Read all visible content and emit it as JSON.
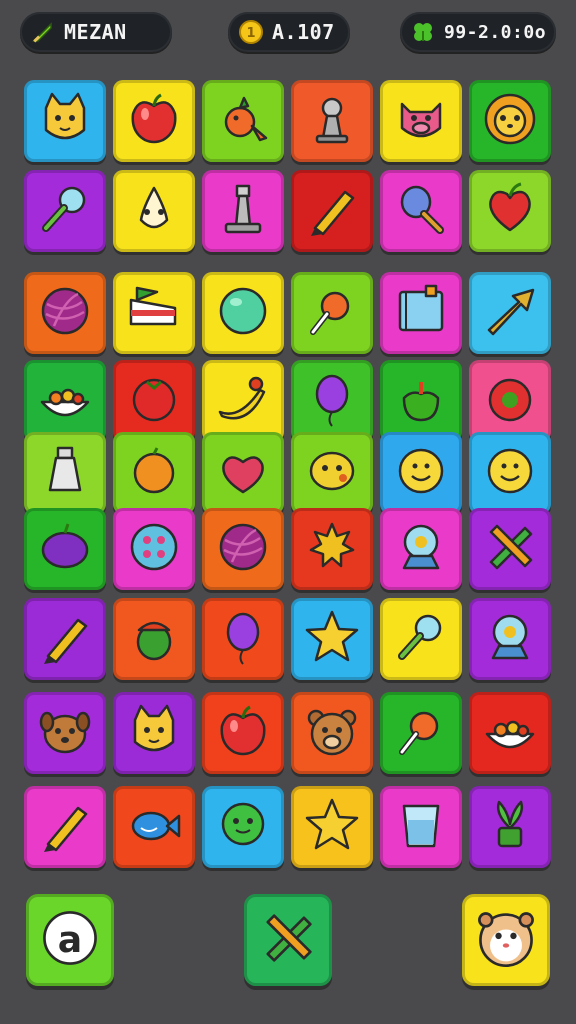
{
  "hud": {
    "left": {
      "text": "MEZAN",
      "icon": "sword-icon"
    },
    "mid": {
      "text": "A.107",
      "icon": "coin-icon"
    },
    "right": {
      "text": "99-2.0:0o",
      "icon": "clover-icon"
    }
  },
  "board": {
    "rows": [
      [
        {
          "c": "#2fb4ee",
          "i": "cat-face"
        },
        {
          "c": "#f7e21b",
          "i": "apple"
        },
        {
          "c": "#7ed321",
          "i": "rooster"
        },
        {
          "c": "#f05a2a",
          "i": "chess-pawn"
        },
        {
          "c": "#f7e21b",
          "i": "pig-face"
        },
        {
          "c": "#27b52a",
          "i": "lion-face"
        }
      ],
      [
        {
          "c": "#a32bd9",
          "i": "magnifier"
        },
        {
          "c": "#f7e21b",
          "i": "onion"
        },
        {
          "c": "#e93ac9",
          "i": "chess-rook"
        },
        {
          "c": "#d61f1f",
          "i": "crayon"
        },
        {
          "c": "#e93ac9",
          "i": "hand-mirror"
        },
        {
          "c": "#8dd62a",
          "i": "heart-fruit"
        }
      ],
      [
        {
          "c": "#f06a1c",
          "i": "yarn-ball"
        },
        {
          "c": "#f7e21b",
          "i": "cake-slice"
        },
        {
          "c": "#f7e21b",
          "i": "ball"
        },
        {
          "c": "#7ed321",
          "i": "lollipop"
        },
        {
          "c": "#e93ac9",
          "i": "notebook"
        },
        {
          "c": "#3cc0ee",
          "i": "arrow"
        }
      ],
      [
        {
          "c": "#22b33b",
          "i": "fruit-bowl"
        },
        {
          "c": "#e52a1f",
          "i": "tomato"
        },
        {
          "c": "#f7e21b",
          "i": "banana"
        },
        {
          "c": "#3fc12a",
          "i": "balloon"
        },
        {
          "c": "#27b52a",
          "i": "bell-pepper"
        },
        {
          "c": "#f0508e",
          "i": "tomato-slice"
        }
      ],
      [
        {
          "c": "#8dd62a",
          "i": "bottle"
        },
        {
          "c": "#7ed321",
          "i": "orange"
        },
        {
          "c": "#7ed321",
          "i": "heart"
        },
        {
          "c": "#7ed321",
          "i": "lemon-face"
        },
        {
          "c": "#2fa8ee",
          "i": "smiley"
        },
        {
          "c": "#2fb4ee",
          "i": "smiley"
        }
      ],
      [
        {
          "c": "#27b52a",
          "i": "plum"
        },
        {
          "c": "#e93ac9",
          "i": "button"
        },
        {
          "c": "#f06a1c",
          "i": "yarn-ball"
        },
        {
          "c": "#e5381f",
          "i": "sun-fruit"
        },
        {
          "c": "#e93ac9",
          "i": "snow-globe"
        },
        {
          "c": "#a32bd9",
          "i": "crossed-tools"
        }
      ],
      [
        {
          "c": "#9b2bd6",
          "i": "crayon"
        },
        {
          "c": "#f0581f",
          "i": "acorn"
        },
        {
          "c": "#f04a1c",
          "i": "balloon"
        },
        {
          "c": "#2fb4ee",
          "i": "star"
        },
        {
          "c": "#f7e21b",
          "i": "magnifier"
        },
        {
          "c": "#a32bd9",
          "i": "snow-globe"
        }
      ],
      [
        {
          "c": "#a32bd9",
          "i": "dog-face"
        },
        {
          "c": "#9b2bd6",
          "i": "cat-face"
        },
        {
          "c": "#f0401c",
          "i": "apple"
        },
        {
          "c": "#f0581f",
          "i": "bear-face"
        },
        {
          "c": "#27b52a",
          "i": "lollipop"
        },
        {
          "c": "#e5281f",
          "i": "fruit-bowl"
        }
      ],
      [
        {
          "c": "#e93ac9",
          "i": "crayon"
        },
        {
          "c": "#f0481c",
          "i": "fish"
        },
        {
          "c": "#2fb4ee",
          "i": "green-blob"
        },
        {
          "c": "#f7c21b",
          "i": "star"
        },
        {
          "c": "#e93ac9",
          "i": "glass"
        },
        {
          "c": "#a32bd9",
          "i": "plant"
        }
      ]
    ]
  },
  "buttons": [
    {
      "c": "#6ad62a",
      "i": "letter-a"
    },
    {
      "c": "#27b55a",
      "i": "crossed-tools"
    },
    {
      "c": "#f7e21b",
      "i": "hamster-face"
    }
  ]
}
